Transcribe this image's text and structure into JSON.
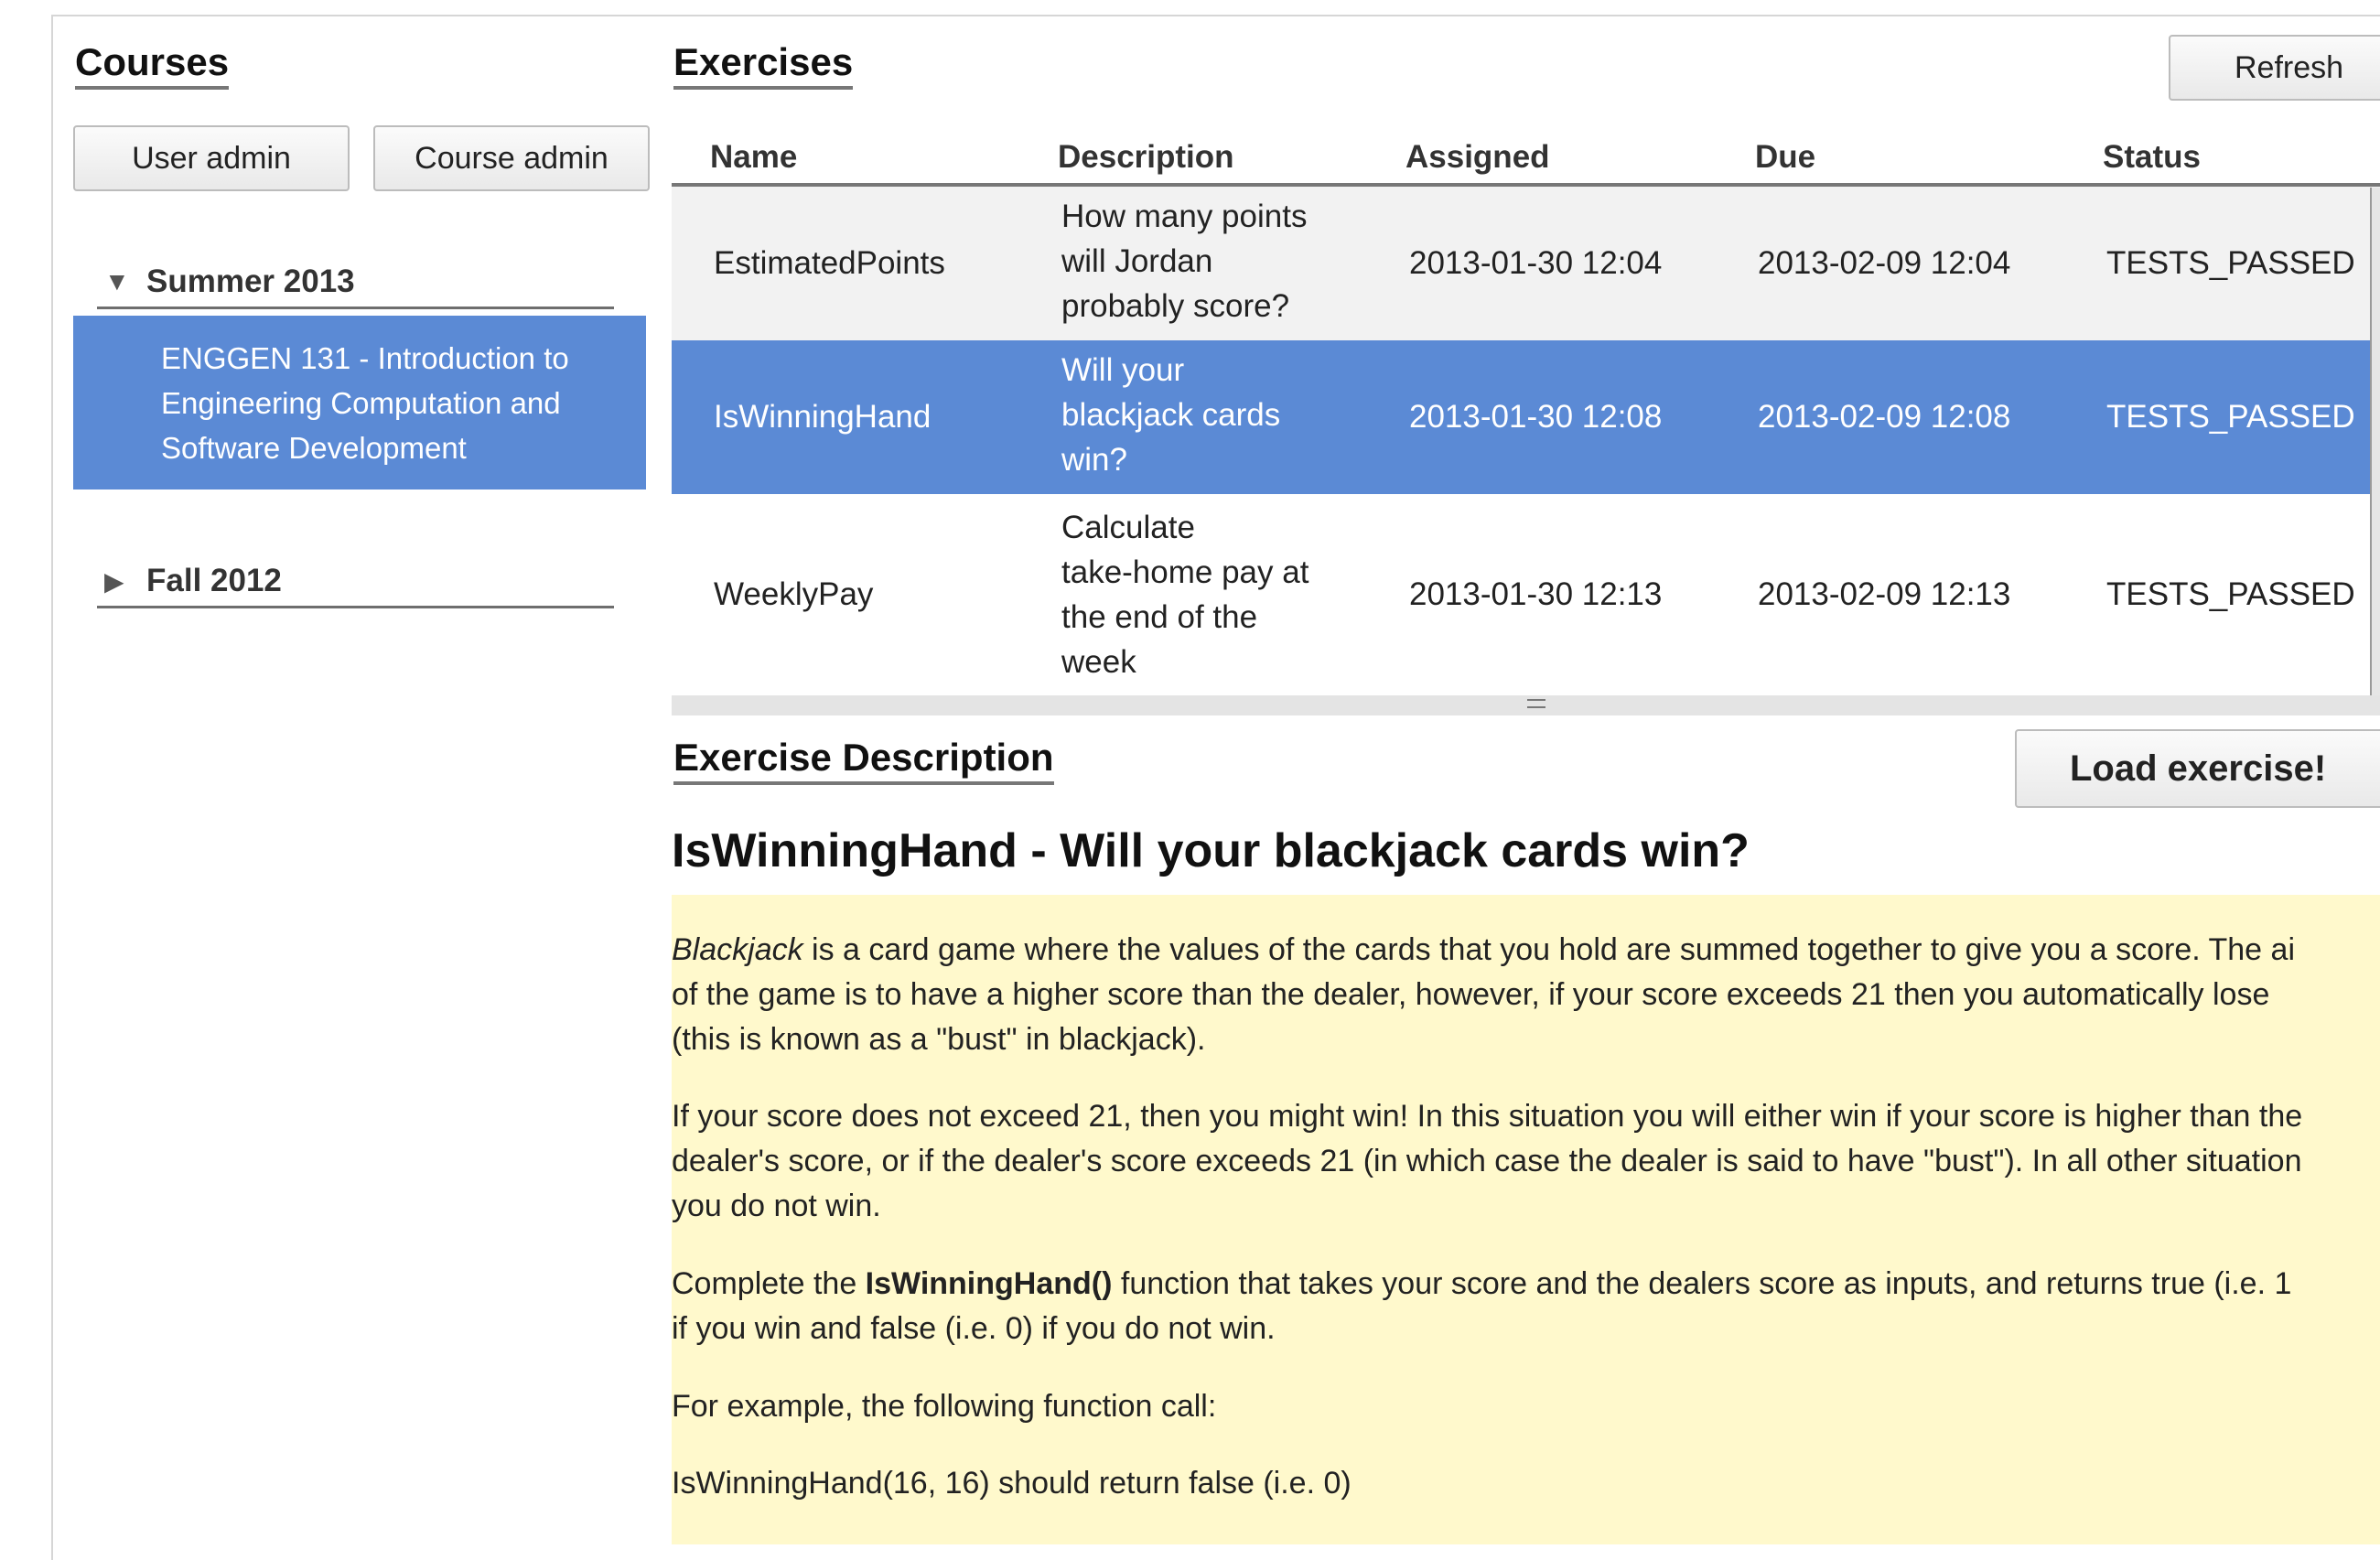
{
  "courses_panel": {
    "heading": "Courses",
    "user_admin_label": "User admin",
    "course_admin_label": "Course admin",
    "terms": [
      {
        "label": "Summer 2013",
        "expanded": true,
        "arrow": "▼"
      },
      {
        "label": "Fall 2012",
        "expanded": false,
        "arrow": "▶"
      }
    ],
    "selected_course": {
      "line1": "ENGGEN 131 - Introduction to",
      "line2": "Engineering Computation and",
      "line3": "Software Development"
    }
  },
  "exercises_panel": {
    "heading": "Exercises",
    "refresh_label": "Refresh",
    "columns": [
      "Name",
      "Description",
      "Assigned",
      "Due",
      "Status"
    ],
    "rows": [
      {
        "name": "EstimatedPoints",
        "desc_lines": [
          "How many points",
          "will Jordan",
          "probably score?"
        ],
        "assigned": "2013-01-30 12:04",
        "due": "2013-02-09 12:04",
        "status": "TESTS_PASSED"
      },
      {
        "name": "IsWinningHand",
        "desc_lines": [
          "Will your",
          "blackjack cards",
          "win?"
        ],
        "assigned": "2013-01-30 12:08",
        "due": "2013-02-09 12:08",
        "status": "TESTS_PASSED"
      },
      {
        "name": "WeeklyPay",
        "desc_lines": [
          "Calculate",
          "take-home pay at",
          "the end of the",
          "week"
        ],
        "assigned": "2013-01-30 12:13",
        "due": "2013-02-09 12:13",
        "status": "TESTS_PASSED"
      }
    ],
    "selected_row_index": 1
  },
  "description_panel": {
    "heading": "Exercise Description",
    "load_label": "Load exercise!",
    "title": "IsWinningHand - Will your blackjack cards win?",
    "p1_em": "Blackjack",
    "p1_line1_rest": " is a card game where the values of the cards that you hold are summed together to give you a score. The ai",
    "p1_line2": "of the game is to have a higher score than the dealer, however, if your score exceeds 21 then you automatically lose",
    "p1_line3": "(this is known as a \"bust\" in blackjack).",
    "p2_line1": "If your score does not exceed 21, then you might win! In this situation you will either win if your score is higher than the",
    "p2_line2": "dealer's score, or if the dealer's score exceeds 21 (in which case the dealer is said to have \"bust\"). In all other situation",
    "p2_line3": "you do not win.",
    "p3_pre": "Complete the ",
    "p3_bold": "IsWinningHand()",
    "p3_line1_rest": " function that takes your score and the dealers score as inputs, and returns true (i.e. 1",
    "p3_line2": "if you win and false (i.e. 0) if you do not win.",
    "p4": "For example, the following function call:",
    "p5": "IsWinningHand(16, 16) should return false (i.e. 0)"
  },
  "colors": {
    "selection": "#5b8ad5",
    "description_bg": "#fff9cc",
    "alt_row": "#f2f2f2"
  }
}
